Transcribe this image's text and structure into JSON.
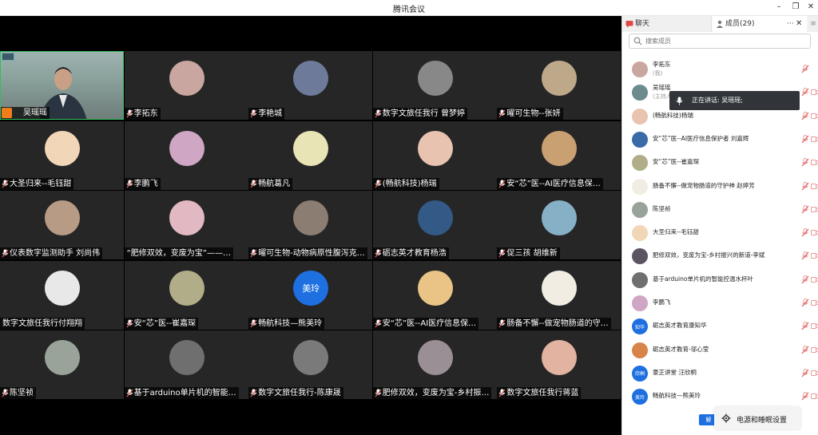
{
  "window": {
    "title": "腾讯会议",
    "minimize": "–",
    "restore": "❐",
    "close": "✕"
  },
  "tiles": [
    {
      "name": "吴瑶瑶",
      "type": "camera"
    },
    {
      "name": "李拓东",
      "color": "#c9a6a0"
    },
    {
      "name": "李艳城",
      "color": "#6d7a9a"
    },
    {
      "name": "数字文旅任我行 曾梦婷",
      "color": "#888888"
    },
    {
      "name": "曜可生物--张妍",
      "color": "#bda98a"
    },
    {
      "name": "大圣归来--毛钰甜",
      "color": "#f2d6b8"
    },
    {
      "name": "李鹏飞",
      "color": "#cfa6c4"
    },
    {
      "name": "畅航葛凡",
      "color": "#e9e4b5"
    },
    {
      "name": "(畅航科技)杨瑞",
      "color": "#e8c3b0"
    },
    {
      "name": "安“芯”医--AI医疗信息保…",
      "color": "#c8a072"
    },
    {
      "name": "仪表数字监测助手  刘尚伟",
      "color": "#b79b85"
    },
    {
      "name": "“肥修双效，变废为宝”——…",
      "color": "#e2b9c2",
      "nomic": true
    },
    {
      "name": "曜可生物-动物病原性腹泻克…",
      "color": "#8c7d73"
    },
    {
      "name": "砺志英才教育杨浩",
      "color": "#335a86"
    },
    {
      "name": "促三孩 胡维新",
      "color": "#86b0c6"
    },
    {
      "name": "数字文旅任我行付翔翔",
      "color": "#e8e8e8",
      "nomic": true
    },
    {
      "name": "安“芯”医--崔嘉琛",
      "color": "#b0ad88"
    },
    {
      "name": "畅航科技—熊美玲",
      "text": "美玲",
      "color": "#1e6fe0"
    },
    {
      "name": "安“芯”医--AI医疗信息保…",
      "color": "#e9c486"
    },
    {
      "name": "肠备不懈--做宠物肠道的守…",
      "color": "#f2ede2"
    },
    {
      "name": "陈坚祯",
      "color": "#9aa39a"
    },
    {
      "name": "基于arduino单片机的智能…",
      "color": "#6f6f6f"
    },
    {
      "name": "数字文旅任我行-陈康晟",
      "color": "#7a7a7a"
    },
    {
      "name": "肥修双效，变废为宝-乡村振…",
      "color": "#9b8f96"
    },
    {
      "name": "数字文旅任我行蒋蓝",
      "color": "#e2b3a0"
    }
  ],
  "panel": {
    "tab_chat": "聊天",
    "tab_members": "成员(29)",
    "more": "···",
    "close": "✕",
    "menu": "≡",
    "search_placeholder": "搜索成员",
    "members": [
      {
        "name": "李拓东",
        "sub": "(我)",
        "color": "#c9a6a0"
      },
      {
        "name": "吴瑶瑶",
        "sub": "(主持人)",
        "color": "#6d8a8c"
      },
      {
        "name": "(畅航科技)杨瑞",
        "color": "#e8c3b0"
      },
      {
        "name": "安“芯”医--AI医疗信息保护者 刘嘉辉",
        "color": "#3a6aa8"
      },
      {
        "name": "安“芯”医--崔嘉琛",
        "color": "#b0ad88"
      },
      {
        "name": "肠备不懈--做宠物肠道的守护神  赵婷芳",
        "color": "#f2ede2"
      },
      {
        "name": "陈坚祯",
        "color": "#9aa39a"
      },
      {
        "name": "大圣归来--毛钰甜",
        "color": "#f2d6b8"
      },
      {
        "name": "肥修双效，变废为宝-乡村振兴的新道-李斌",
        "color": "#5a5560"
      },
      {
        "name": "基于arduino单片机的智能控温水杯叶",
        "color": "#6f6f6f"
      },
      {
        "name": "李鹏飞",
        "color": "#cfa6c4"
      },
      {
        "name": "砺志英才教育康知华",
        "text": "知华",
        "color": "#1e6fe0"
      },
      {
        "name": "砺志英才教育-邬心莹",
        "color": "#d8834a"
      },
      {
        "name": "豪正讲堂 汪欣桐",
        "text": "欣桐",
        "color": "#1e6fe0"
      },
      {
        "name": "畅航科技—熊美玲",
        "text": "美玲",
        "color": "#1e6fe0"
      }
    ],
    "speaking_text": "正在讲话: 吴瑶瑶;",
    "blue_button": "解",
    "power_popup": "电源和睡眠设置"
  },
  "colors": {
    "accent": "#1e6fe0",
    "host": "#f07c1b",
    "active_border": "#2fbf5a",
    "mic_off": "#e05a5a"
  }
}
